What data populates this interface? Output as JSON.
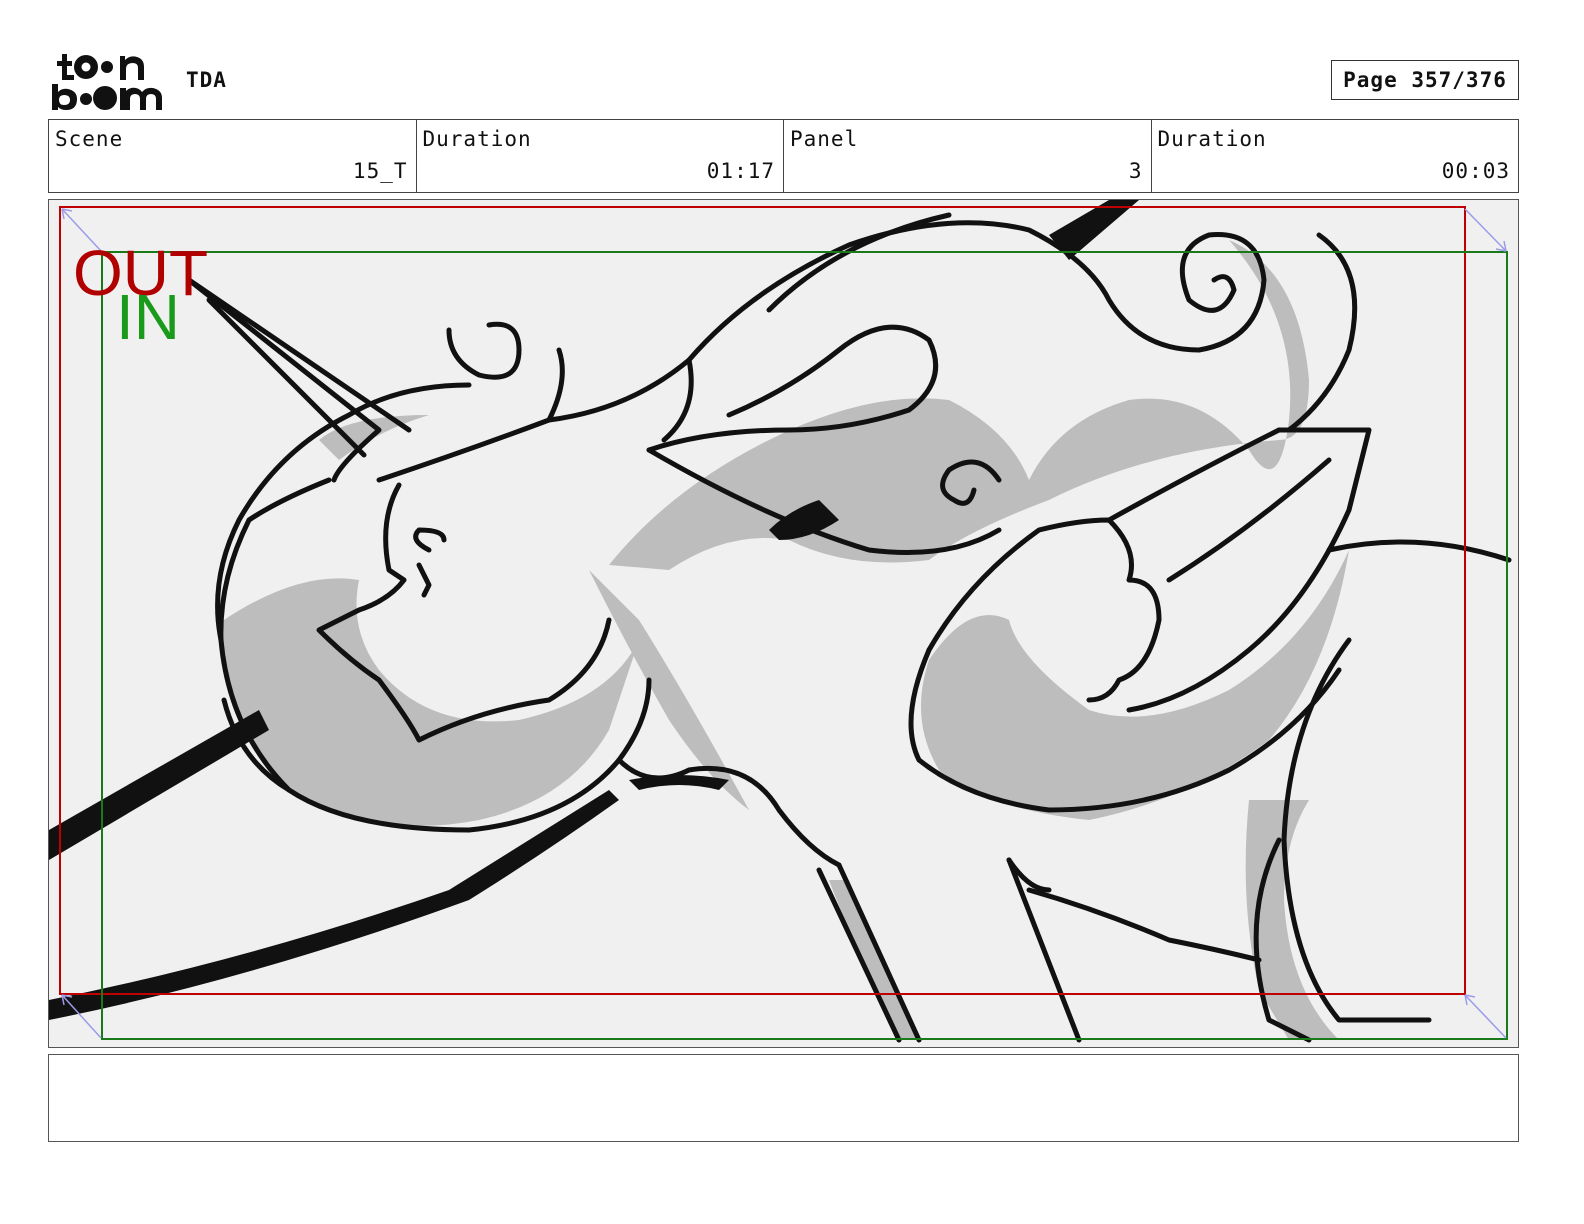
{
  "header": {
    "logo_text": "toon boom",
    "project": "TDA",
    "page_label": "Page 357/376"
  },
  "info": {
    "scene_label": "Scene",
    "scene_value": "15_T",
    "scene_duration_label": "Duration",
    "scene_duration_value": "01:17",
    "panel_label": "Panel",
    "panel_value": "3",
    "panel_duration_label": "Duration",
    "panel_duration_value": "00:03"
  },
  "panel": {
    "out_label": "OUT",
    "in_label": "IN",
    "out_color": "#b00000",
    "in_color": "#1a9a1a"
  },
  "notes": {
    "text": ""
  }
}
